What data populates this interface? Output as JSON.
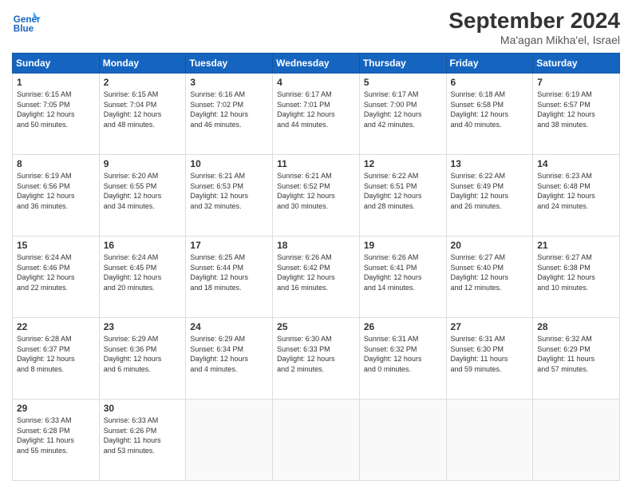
{
  "logo": {
    "line1": "General",
    "line2": "Blue"
  },
  "title": "September 2024",
  "location": "Ma'agan Mikha'el, Israel",
  "days_header": [
    "Sunday",
    "Monday",
    "Tuesday",
    "Wednesday",
    "Thursday",
    "Friday",
    "Saturday"
  ],
  "weeks": [
    [
      {
        "num": "1",
        "info": "Sunrise: 6:15 AM\nSunset: 7:05 PM\nDaylight: 12 hours\nand 50 minutes."
      },
      {
        "num": "2",
        "info": "Sunrise: 6:15 AM\nSunset: 7:04 PM\nDaylight: 12 hours\nand 48 minutes."
      },
      {
        "num": "3",
        "info": "Sunrise: 6:16 AM\nSunset: 7:02 PM\nDaylight: 12 hours\nand 46 minutes."
      },
      {
        "num": "4",
        "info": "Sunrise: 6:17 AM\nSunset: 7:01 PM\nDaylight: 12 hours\nand 44 minutes."
      },
      {
        "num": "5",
        "info": "Sunrise: 6:17 AM\nSunset: 7:00 PM\nDaylight: 12 hours\nand 42 minutes."
      },
      {
        "num": "6",
        "info": "Sunrise: 6:18 AM\nSunset: 6:58 PM\nDaylight: 12 hours\nand 40 minutes."
      },
      {
        "num": "7",
        "info": "Sunrise: 6:19 AM\nSunset: 6:57 PM\nDaylight: 12 hours\nand 38 minutes."
      }
    ],
    [
      {
        "num": "8",
        "info": "Sunrise: 6:19 AM\nSunset: 6:56 PM\nDaylight: 12 hours\nand 36 minutes."
      },
      {
        "num": "9",
        "info": "Sunrise: 6:20 AM\nSunset: 6:55 PM\nDaylight: 12 hours\nand 34 minutes."
      },
      {
        "num": "10",
        "info": "Sunrise: 6:21 AM\nSunset: 6:53 PM\nDaylight: 12 hours\nand 32 minutes."
      },
      {
        "num": "11",
        "info": "Sunrise: 6:21 AM\nSunset: 6:52 PM\nDaylight: 12 hours\nand 30 minutes."
      },
      {
        "num": "12",
        "info": "Sunrise: 6:22 AM\nSunset: 6:51 PM\nDaylight: 12 hours\nand 28 minutes."
      },
      {
        "num": "13",
        "info": "Sunrise: 6:22 AM\nSunset: 6:49 PM\nDaylight: 12 hours\nand 26 minutes."
      },
      {
        "num": "14",
        "info": "Sunrise: 6:23 AM\nSunset: 6:48 PM\nDaylight: 12 hours\nand 24 minutes."
      }
    ],
    [
      {
        "num": "15",
        "info": "Sunrise: 6:24 AM\nSunset: 6:46 PM\nDaylight: 12 hours\nand 22 minutes."
      },
      {
        "num": "16",
        "info": "Sunrise: 6:24 AM\nSunset: 6:45 PM\nDaylight: 12 hours\nand 20 minutes."
      },
      {
        "num": "17",
        "info": "Sunrise: 6:25 AM\nSunset: 6:44 PM\nDaylight: 12 hours\nand 18 minutes."
      },
      {
        "num": "18",
        "info": "Sunrise: 6:26 AM\nSunset: 6:42 PM\nDaylight: 12 hours\nand 16 minutes."
      },
      {
        "num": "19",
        "info": "Sunrise: 6:26 AM\nSunset: 6:41 PM\nDaylight: 12 hours\nand 14 minutes."
      },
      {
        "num": "20",
        "info": "Sunrise: 6:27 AM\nSunset: 6:40 PM\nDaylight: 12 hours\nand 12 minutes."
      },
      {
        "num": "21",
        "info": "Sunrise: 6:27 AM\nSunset: 6:38 PM\nDaylight: 12 hours\nand 10 minutes."
      }
    ],
    [
      {
        "num": "22",
        "info": "Sunrise: 6:28 AM\nSunset: 6:37 PM\nDaylight: 12 hours\nand 8 minutes."
      },
      {
        "num": "23",
        "info": "Sunrise: 6:29 AM\nSunset: 6:36 PM\nDaylight: 12 hours\nand 6 minutes."
      },
      {
        "num": "24",
        "info": "Sunrise: 6:29 AM\nSunset: 6:34 PM\nDaylight: 12 hours\nand 4 minutes."
      },
      {
        "num": "25",
        "info": "Sunrise: 6:30 AM\nSunset: 6:33 PM\nDaylight: 12 hours\nand 2 minutes."
      },
      {
        "num": "26",
        "info": "Sunrise: 6:31 AM\nSunset: 6:32 PM\nDaylight: 12 hours\nand 0 minutes."
      },
      {
        "num": "27",
        "info": "Sunrise: 6:31 AM\nSunset: 6:30 PM\nDaylight: 11 hours\nand 59 minutes."
      },
      {
        "num": "28",
        "info": "Sunrise: 6:32 AM\nSunset: 6:29 PM\nDaylight: 11 hours\nand 57 minutes."
      }
    ],
    [
      {
        "num": "29",
        "info": "Sunrise: 6:33 AM\nSunset: 6:28 PM\nDaylight: 11 hours\nand 55 minutes."
      },
      {
        "num": "30",
        "info": "Sunrise: 6:33 AM\nSunset: 6:26 PM\nDaylight: 11 hours\nand 53 minutes."
      },
      {
        "num": "",
        "info": ""
      },
      {
        "num": "",
        "info": ""
      },
      {
        "num": "",
        "info": ""
      },
      {
        "num": "",
        "info": ""
      },
      {
        "num": "",
        "info": ""
      }
    ]
  ]
}
